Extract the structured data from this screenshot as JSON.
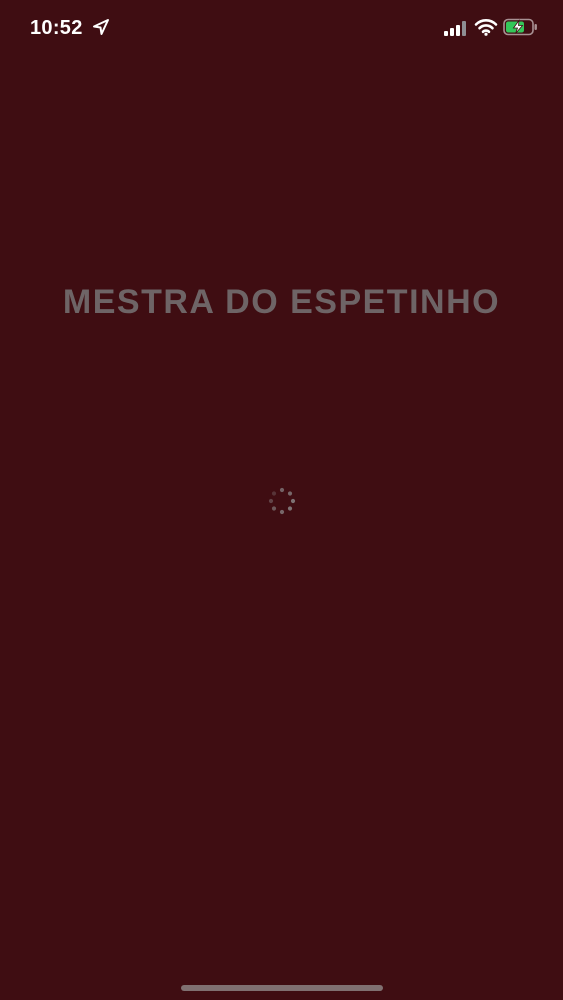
{
  "status_bar": {
    "time": "10:52",
    "location_icon": "location-arrow-icon",
    "signal_icon": "cellular-signal-icon",
    "wifi_icon": "wifi-icon",
    "battery_icon": "battery-charging-icon",
    "battery_level": 0.7,
    "text_color": "#ffffff",
    "battery_color": "#34c759"
  },
  "splash": {
    "title": "MESTRA DO ESPETINHO",
    "background_color": "#3f0d12",
    "title_color": "#6e6466",
    "spinner_icon": "loading-spinner-icon"
  },
  "home_indicator": {
    "icon": "home-indicator-bar"
  }
}
